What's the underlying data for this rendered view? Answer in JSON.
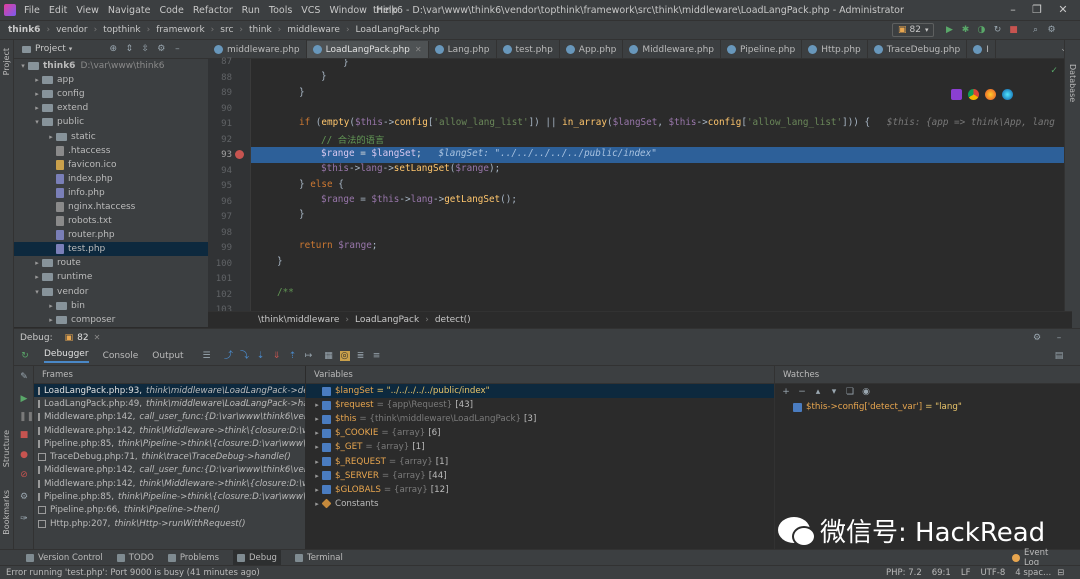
{
  "menubar": {
    "items": [
      "File",
      "Edit",
      "View",
      "Navigate",
      "Code",
      "Refactor",
      "Run",
      "Tools",
      "VCS",
      "Window",
      "Help"
    ],
    "title": "think6 - D:\\var\\www\\think6\\vendor\\topthink\\framework\\src\\think\\middleware\\LoadLangPack.php - Administrator"
  },
  "navbar": {
    "crumbs": [
      "think6",
      "vendor",
      "topthink",
      "framework",
      "src",
      "think",
      "middleware",
      "LoadLangPack.php"
    ],
    "run_config": "82"
  },
  "project": {
    "header": "Project",
    "tree": [
      {
        "label": "think6",
        "suffix": "D:\\var\\www\\think6",
        "type": "folder",
        "depth": 0,
        "arrow": "▾"
      },
      {
        "label": "app",
        "type": "folder",
        "depth": 1,
        "arrow": "▸"
      },
      {
        "label": "config",
        "type": "folder",
        "depth": 1,
        "arrow": "▸"
      },
      {
        "label": "extend",
        "type": "folder",
        "depth": 1,
        "arrow": "▸"
      },
      {
        "label": "public",
        "type": "folder",
        "depth": 1,
        "arrow": "▾"
      },
      {
        "label": "static",
        "type": "folder",
        "depth": 2,
        "arrow": "▸"
      },
      {
        "label": ".htaccess",
        "type": "file",
        "depth": 2,
        "arrow": ""
      },
      {
        "label": "favicon.ico",
        "type": "ico",
        "depth": 2,
        "arrow": ""
      },
      {
        "label": "index.php",
        "type": "php",
        "depth": 2,
        "arrow": ""
      },
      {
        "label": "info.php",
        "type": "php",
        "depth": 2,
        "arrow": ""
      },
      {
        "label": "nginx.htaccess",
        "type": "file",
        "depth": 2,
        "arrow": ""
      },
      {
        "label": "robots.txt",
        "type": "file",
        "depth": 2,
        "arrow": ""
      },
      {
        "label": "router.php",
        "type": "php",
        "depth": 2,
        "arrow": ""
      },
      {
        "label": "test.php",
        "type": "php",
        "depth": 2,
        "arrow": "",
        "selected": true
      },
      {
        "label": "route",
        "type": "folder",
        "depth": 1,
        "arrow": "▸"
      },
      {
        "label": "runtime",
        "type": "folder",
        "depth": 1,
        "arrow": "▸"
      },
      {
        "label": "vendor",
        "type": "folder",
        "depth": 1,
        "arrow": "▾"
      },
      {
        "label": "bin",
        "type": "folder",
        "depth": 2,
        "arrow": "▸"
      },
      {
        "label": "composer",
        "type": "folder",
        "depth": 2,
        "arrow": "▸"
      }
    ]
  },
  "tabs": [
    {
      "label": "middleware.php",
      "active": false
    },
    {
      "label": "LoadLangPack.php",
      "active": true
    },
    {
      "label": "Lang.php",
      "active": false
    },
    {
      "label": "test.php",
      "active": false
    },
    {
      "label": "App.php",
      "active": false
    },
    {
      "label": "Middleware.php",
      "active": false
    },
    {
      "label": "Pipeline.php",
      "active": false
    },
    {
      "label": "Http.php",
      "active": false
    },
    {
      "label": "TraceDebug.php",
      "active": false
    },
    {
      "label": "I",
      "active": false
    }
  ],
  "editor": {
    "line_numbers": [
      "87",
      "88",
      "89",
      "90",
      "91",
      "92",
      "93",
      "94",
      "95",
      "96",
      "97",
      "98",
      "99",
      "100",
      "101",
      "102",
      "103"
    ],
    "hint_line_91": "$this: {app => think\\App, lang",
    "comment_line_92": "// 合法的语言",
    "hint_line_93": "$langSet: \"../../../../../public/index\"",
    "breadcrumb": [
      "\\think\\middleware",
      "LoadLangPack",
      "detect()"
    ]
  },
  "debug": {
    "label": "Debug:",
    "session": "82",
    "tabs": [
      "Debugger",
      "Console",
      "Output"
    ],
    "frames_title": "Frames",
    "variables_title": "Variables",
    "watches_title": "Watches",
    "frames": [
      {
        "loc": "LoadLangPack.php:93,",
        "call": "think\\middleware\\LoadLangPack->de",
        "selected": true
      },
      {
        "loc": "LoadLangPack.php:49,",
        "call": "think\\middleware\\LoadLangPack->ha"
      },
      {
        "loc": "Middleware.php:142,",
        "call": "call_user_func:{D:\\var\\www\\think6\\veno"
      },
      {
        "loc": "Middleware.php:142,",
        "call": "think\\Middleware->think\\{closure:D:\\va"
      },
      {
        "loc": "Pipeline.php:85,",
        "call": "think\\Pipeline->think\\{closure:D:\\var\\www\\th"
      },
      {
        "loc": "TraceDebug.php:71,",
        "call": "think\\trace\\TraceDebug->handle()"
      },
      {
        "loc": "Middleware.php:142,",
        "call": "call_user_func:{D:\\var\\www\\think6\\veno"
      },
      {
        "loc": "Middleware.php:142,",
        "call": "think\\Middleware->think\\{closure:D:\\va"
      },
      {
        "loc": "Pipeline.php:85,",
        "call": "think\\Pipeline->think\\{closure:D:\\var\\www\\th"
      },
      {
        "loc": "Pipeline.php:66,",
        "call": "think\\Pipeline->then()"
      },
      {
        "loc": "Http.php:207,",
        "call": "think\\Http->runWithRequest()"
      }
    ],
    "variables": [
      {
        "arrow": "",
        "name": "$langSet",
        "type": "",
        "value": "= \"../../../../../public/index\"",
        "str": true,
        "selected": true
      },
      {
        "arrow": "▸",
        "name": "$request",
        "type": "= {app\\Request}",
        "value": "[43]"
      },
      {
        "arrow": "▸",
        "name": "$this",
        "type": "= {think\\middleware\\LoadLangPack}",
        "value": "[3]"
      },
      {
        "arrow": "▸",
        "name": "$_COOKIE",
        "type": "= {array}",
        "value": "[6]"
      },
      {
        "arrow": "▸",
        "name": "$_GET",
        "type": "= {array}",
        "value": "[1]"
      },
      {
        "arrow": "▸",
        "name": "$_REQUEST",
        "type": "= {array}",
        "value": "[1]"
      },
      {
        "arrow": "▸",
        "name": "$_SERVER",
        "type": "= {array}",
        "value": "[44]"
      },
      {
        "arrow": "▸",
        "name": "$GLOBALS",
        "type": "= {array}",
        "value": "[12]"
      },
      {
        "arrow": "▸",
        "name": "Constants",
        "type": "",
        "value": "",
        "const": true
      }
    ],
    "watches": [
      {
        "expr": "$this->config['detect_var']",
        "value": "= \"lang\""
      }
    ]
  },
  "bottom_tools": [
    "Version Control",
    "TODO",
    "Problems",
    "Debug",
    "Terminal"
  ],
  "event_log": "Event Log",
  "status": {
    "message": "Error running 'test.php': Port 9000 is busy (41 minutes ago)",
    "php": "PHP: 7.2",
    "position": "69:1",
    "line_sep": "LF",
    "encoding": "UTF-8",
    "indent": "4 spac..."
  },
  "side_labels": {
    "project": "Project",
    "structure": "Structure",
    "bookmarks": "Bookmarks",
    "database": "Database"
  },
  "watermark": "微信号: HackRead"
}
